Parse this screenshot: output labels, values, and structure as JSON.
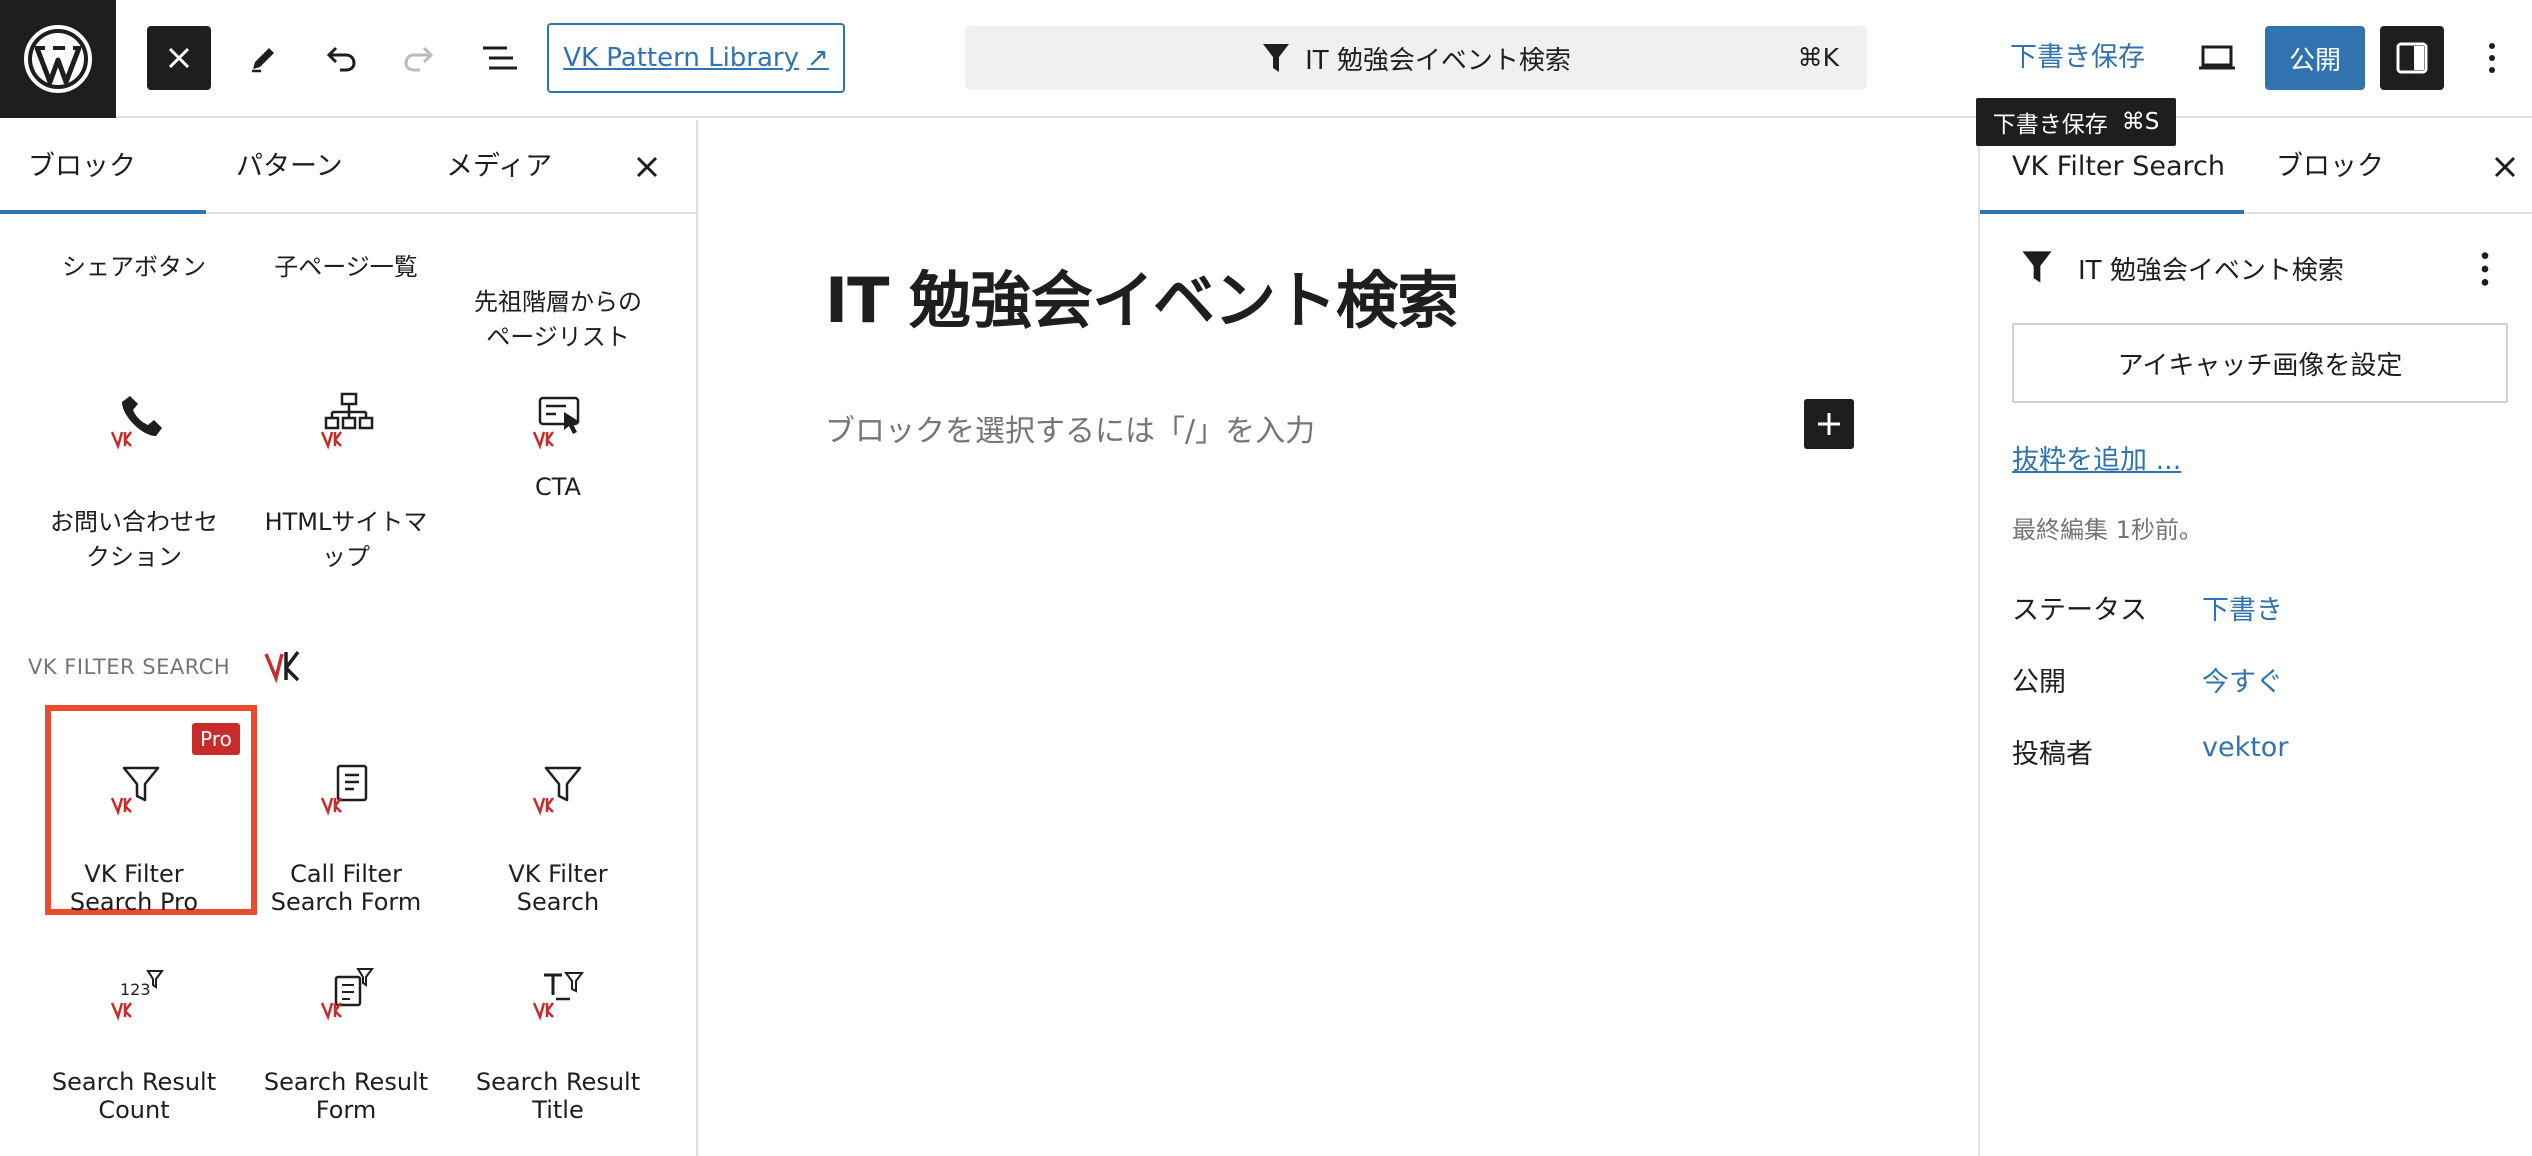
{
  "topbar": {
    "pattern_library": "VK Pattern Library",
    "pattern_library_arrow": "↗",
    "command_title": "IT 勉強会イベント検索",
    "command_shortcut": "⌘K",
    "save_draft": "下書き保存",
    "publish": "公開",
    "tooltip_label": "下書き保存",
    "tooltip_shortcut": "⌘S"
  },
  "left_panel": {
    "tabs": [
      "ブロック",
      "パターン",
      "メディア"
    ],
    "blocks_top": [
      {
        "label": "シェアボタン"
      },
      {
        "label": "子ページ一覧"
      },
      {
        "label": "先祖階層からの\nページリスト"
      }
    ],
    "blocks_row2": [
      {
        "label": "お問い合わせセ\nクション",
        "icon": "phone-icon"
      },
      {
        "label": "HTMLサイトマ\nップ",
        "icon": "sitemap-icon"
      },
      {
        "label": "CTA",
        "icon": "cta-icon"
      }
    ],
    "section_title": "VK FILTER SEARCH",
    "blocks_filter": [
      {
        "label": "VK Filter\nSearch Pro",
        "icon": "filter-icon",
        "badge": "Pro"
      },
      {
        "label": "Call Filter\nSearch Form",
        "icon": "form-icon"
      },
      {
        "label": "VK Filter\nSearch",
        "icon": "filter-icon"
      }
    ],
    "blocks_result": [
      {
        "label": "Search Result\nCount",
        "icon": "count-icon"
      },
      {
        "label": "Search Result\nForm",
        "icon": "form-filter-icon"
      },
      {
        "label": "Search Result\nTitle",
        "icon": "title-filter-icon"
      }
    ]
  },
  "editor": {
    "title": "IT 勉強会イベント検索",
    "placeholder": "ブロックを選択するには「/」を入力"
  },
  "right_panel": {
    "tabs": [
      "VK Filter Search",
      "ブロック"
    ],
    "post_title": "IT 勉強会イベント検索",
    "featured_image": "アイキャッチ画像を設定",
    "excerpt": "抜粋を追加 ...",
    "last_edited": "最終編集 1秒前。",
    "meta": [
      {
        "label": "ステータス",
        "value": "下書き"
      },
      {
        "label": "公開",
        "value": "今すぐ"
      },
      {
        "label": "投稿者",
        "value": "vektor"
      }
    ]
  },
  "colors": {
    "accent": "#3173ae",
    "dark": "#1e1e1e",
    "highlight": "#ea4b2c",
    "pro_badge": "#c92a2a"
  }
}
